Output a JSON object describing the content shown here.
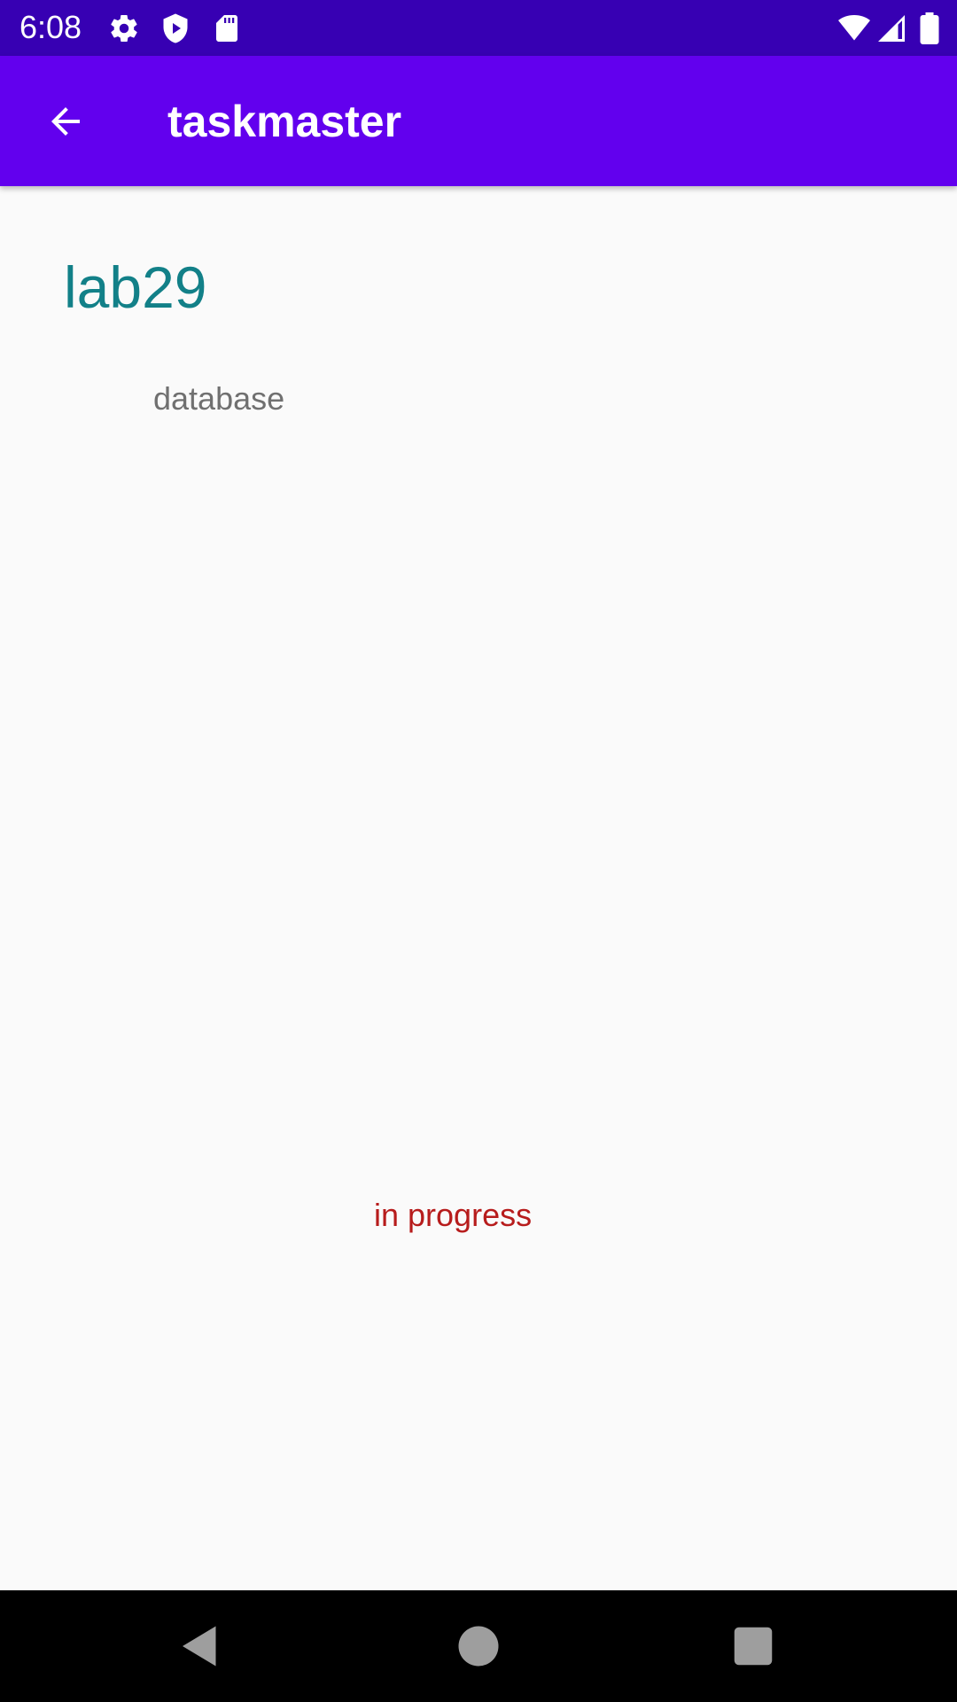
{
  "status_bar": {
    "time": "6:08",
    "left_icons": [
      "settings-icon",
      "play-protect-icon",
      "sd-card-icon"
    ],
    "right_icons": [
      "wifi-icon",
      "signal-icon",
      "battery-icon"
    ]
  },
  "app_bar": {
    "title": "taskmaster",
    "back_icon": "arrow-left-icon",
    "background": "#6200ee"
  },
  "task": {
    "title": "lab29",
    "body": "database",
    "state": "in progress"
  },
  "colors": {
    "status_bar": "#3700b3",
    "title": "#128088",
    "body": "#707070",
    "state": "#b71c1c"
  },
  "nav_bar": {
    "icons": [
      "back-triangle-icon",
      "home-circle-icon",
      "recents-square-icon"
    ]
  }
}
